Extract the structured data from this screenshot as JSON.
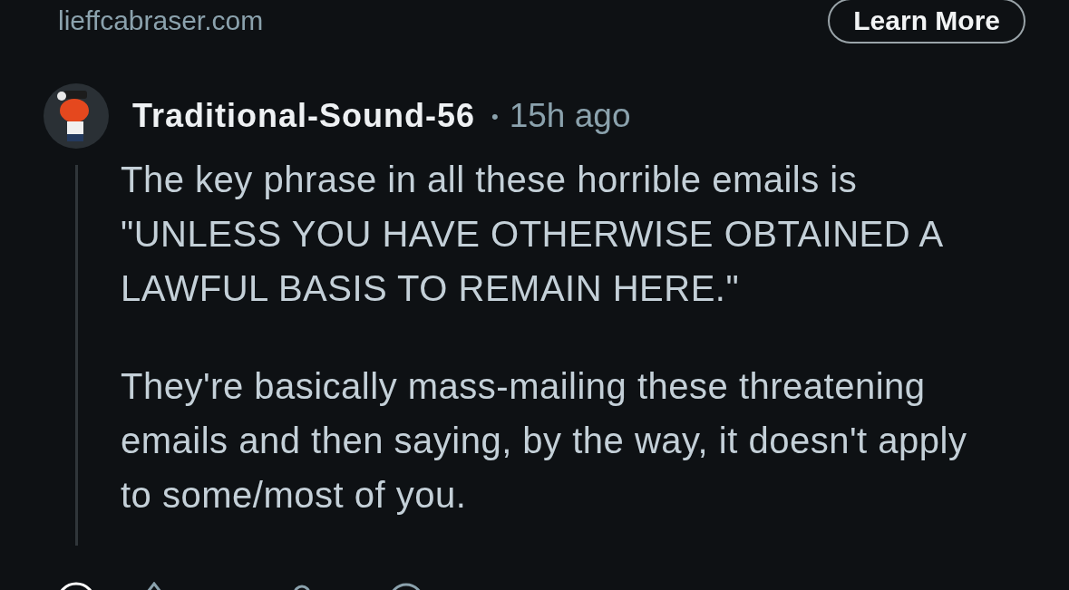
{
  "ad": {
    "domain": "lieffcabraser.com",
    "button": "Learn More"
  },
  "comment": {
    "author": "Traditional-Sound-56",
    "separator": "•",
    "time": "15h ago",
    "paragraphs": [
      "The key phrase in all these horrible emails is \"UNLESS YOU HAVE OTHERWISE OBTAINED A LAWFUL BASIS TO REMAIN HERE.\"",
      "They're basically mass-mailing these threatening emails and then saying, by the way, it doesn't apply to some/most of you."
    ]
  }
}
